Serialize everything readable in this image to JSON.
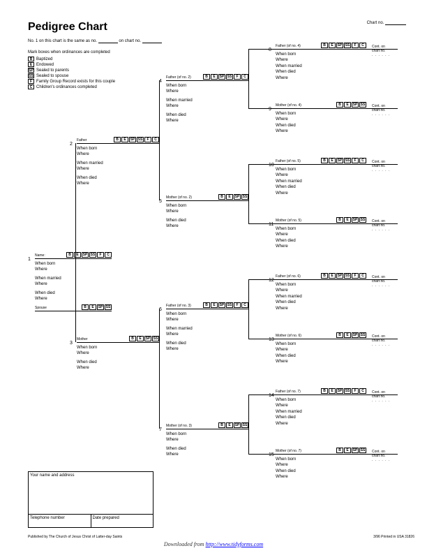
{
  "title": "Pedigree Chart",
  "chartno_label": "Chart no.",
  "subhead": {
    "a": "No. 1 on this chart is the same as no.",
    "b": "on chart no."
  },
  "legend": {
    "title": "Mark boxes when ordinances are completed",
    "items": [
      {
        "code": "B",
        "label": "Baptized"
      },
      {
        "code": "E",
        "label": "Endowed"
      },
      {
        "code": "SP",
        "label": "Sealed to parents"
      },
      {
        "code": "SS",
        "label": "Sealed to spouse"
      },
      {
        "code": "F",
        "label": "Family Group Record exists for this couple"
      },
      {
        "code": "C",
        "label": "Children's ordinances completed"
      }
    ]
  },
  "ord_full": [
    "B",
    "E",
    "SP",
    "SS",
    "F",
    "C"
  ],
  "ord_five": [
    "B",
    "E",
    "SP",
    "SS",
    "F"
  ],
  "ord_four": [
    "B",
    "E",
    "SP",
    "SS"
  ],
  "fields_full": [
    "When born",
    "Where",
    "When married",
    "Where",
    "When died",
    "Where"
  ],
  "fields_nomar": [
    "When born",
    "Where",
    "When died",
    "Where"
  ],
  "roles": {
    "name": "Name:",
    "spouse": "Spouse",
    "father": "Father",
    "mother": "Mother",
    "f2": "Father (of no. 2)",
    "m2": "Mother (of no. 2)",
    "f3": "Father (of no. 3)",
    "m3": "Mother (of no. 3)",
    "f4": "Father (of no. 4)",
    "m4": "Mother (of no. 4)",
    "f5": "Father (of no. 5)",
    "m5": "Mother (of no. 5)",
    "f6": "Father (of no. 6)",
    "m6": "Mother (of no. 6)",
    "f7": "Father (of no. 7)",
    "m7": "Mother (of no. 7)"
  },
  "cont": {
    "a": "Cont. on",
    "b": "chart no."
  },
  "addr": {
    "name": "Your name and address",
    "tel": "Telephone number",
    "date": "Date prepared"
  },
  "footer": {
    "pub": "Published by The Church of Jesus Christ of Latter-day Saints",
    "rev": "3/96  Printed in USA  31826"
  },
  "download": {
    "a": "Downloaded from ",
    "b": "http://www.tidyforms.com"
  }
}
